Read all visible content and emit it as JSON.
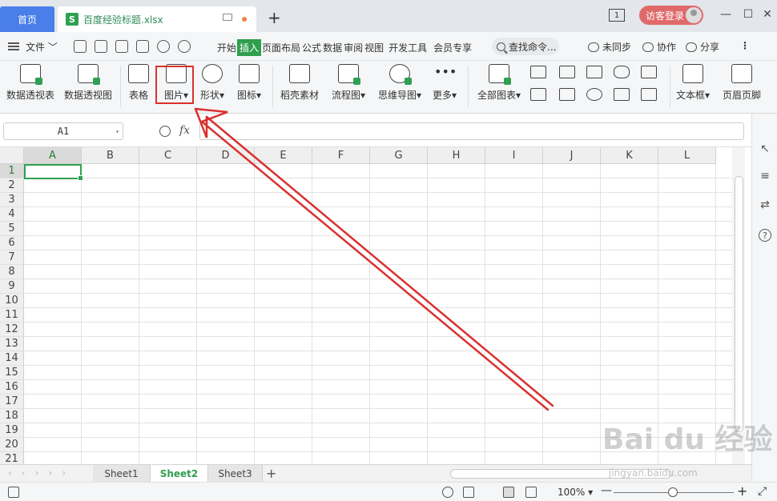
{
  "titlebar": {
    "home_tab": "首页",
    "file_tab": "百度经验标题.xlsx",
    "file_icon_letter": "S",
    "window_count": "1",
    "login_label": "访客登录"
  },
  "menubar": {
    "file_label": "文件",
    "items": [
      "开始",
      "插入",
      "页面布局",
      "公式",
      "数据",
      "审阅",
      "视图",
      "开发工具",
      "会员专享"
    ],
    "active_item": "插入",
    "search_label": "查找命令...",
    "sync_label": "未同步",
    "collab_label": "协作",
    "share_label": "分享"
  },
  "ribbon": {
    "pivot_table": "数据透视表",
    "pivot_chart": "数据透视图",
    "table": "表格",
    "picture": "图片",
    "shape": "形状",
    "icon": "图标",
    "material": "稻壳素材",
    "flowchart": "流程图",
    "mindmap": "思维导图",
    "more": "更多",
    "all_charts": "全部图表",
    "textbox": "文本框",
    "header_footer": "页眉页脚"
  },
  "formula_bar": {
    "cell_ref": "A1",
    "fx_label": "fx",
    "formula": ""
  },
  "grid": {
    "columns": [
      "A",
      "B",
      "C",
      "D",
      "E",
      "F",
      "G",
      "H",
      "I",
      "J",
      "K",
      "L"
    ],
    "rows": [
      "1",
      "2",
      "3",
      "4",
      "5",
      "6",
      "7",
      "8",
      "9",
      "10",
      "11",
      "12",
      "13",
      "14",
      "15",
      "16",
      "17",
      "18",
      "19",
      "20",
      "21"
    ],
    "selected_col": "A",
    "selected_row": "1"
  },
  "sheets": {
    "tabs": [
      "Sheet1",
      "Sheet2",
      "Sheet3"
    ],
    "active": "Sheet2"
  },
  "statusbar": {
    "zoom": "100%"
  },
  "watermark": {
    "main": "Bai du 经验",
    "sub": "jingyan.baidu.com"
  },
  "colors": {
    "accent_green": "#2fa052",
    "highlight_red": "#d9312f",
    "home_tab_blue": "#4a7ee8"
  }
}
